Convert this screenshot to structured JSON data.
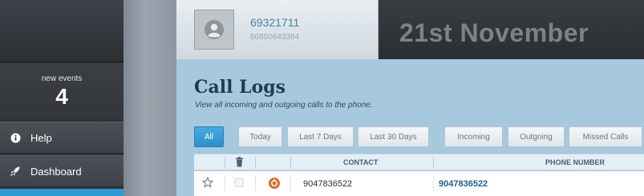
{
  "sidebar": {
    "events_label": "new events",
    "events_count": "4",
    "items": [
      {
        "label": "Help",
        "icon": "info-icon"
      },
      {
        "label": "Dashboard",
        "icon": "rocket-icon"
      }
    ]
  },
  "profile": {
    "name": "69321711",
    "number": "66850643384",
    "avatar_icon": "user-avatar-icon"
  },
  "header": {
    "date": "21st November"
  },
  "main": {
    "title": "Call Logs",
    "subtitle": "View all incoming and outgoing calls to the phone.",
    "filters": [
      "All",
      "Today",
      "Last 7 Days",
      "Last 30 Days",
      "Incoming",
      "Outgoing",
      "Missed Calls"
    ],
    "active_filter": "All"
  },
  "table": {
    "headers": {
      "contact": "CONTACT",
      "phone_number": "PHONE NUMBER"
    },
    "rows": [
      {
        "contact": "9047836522",
        "phone_number": "9047836522",
        "type_icon": "call-type-icon"
      }
    ]
  },
  "colors": {
    "accent": "#2d9ad6",
    "sidebar": "#2f3236",
    "content_bg": "#a7c9dd",
    "call_icon": "#e06a2a"
  }
}
